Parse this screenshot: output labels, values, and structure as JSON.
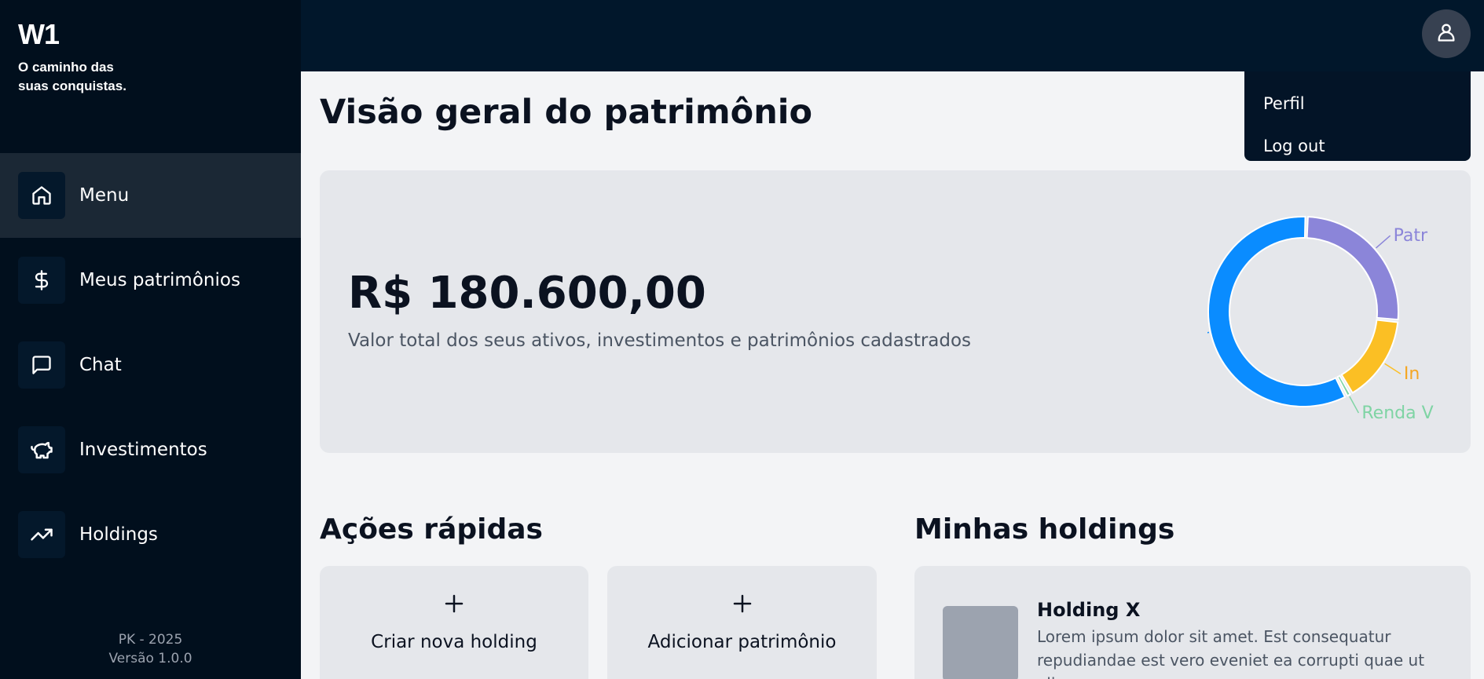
{
  "brand": {
    "logo": "W1",
    "tagline": "O caminho das suas conquistas."
  },
  "nav": {
    "items": [
      {
        "label": "Menu",
        "icon": "home-icon",
        "active": true
      },
      {
        "label": "Meus patrimônios",
        "icon": "dollar-icon",
        "active": false
      },
      {
        "label": "Chat",
        "icon": "chat-icon",
        "active": false
      },
      {
        "label": "Investimentos",
        "icon": "piggy-bank-icon",
        "active": false
      },
      {
        "label": "Holdings",
        "icon": "trending-up-icon",
        "active": false
      }
    ]
  },
  "footer": {
    "line1": "PK - 2025",
    "line2": "Versão 1.0.0"
  },
  "user_menu": {
    "icon": "user-icon",
    "items": [
      "Perfil",
      "Log out"
    ]
  },
  "main": {
    "title": "Visão geral do patrimônio",
    "total_value": "R$ 180.600,00",
    "total_desc": "Valor total dos seus ativos, investimentos e patrimônios cadastrados"
  },
  "chart_data": {
    "type": "pie",
    "style": "donut",
    "categories": [
      "Patr",
      "In",
      "Renda V",
      ""
    ],
    "values": [
      26,
      15,
      1,
      58
    ],
    "colors": [
      "#8b85d9",
      "#fbbf24",
      "#7fd4a4",
      "#0a8cff"
    ],
    "labels_visible": [
      "Patr",
      "In",
      "Renda V"
    ],
    "label_colors": [
      "#8b85d9",
      "#f5a623",
      "#7fd4a4"
    ]
  },
  "quick_actions": {
    "title": "Ações rápidas",
    "items": [
      {
        "label": "Criar nova holding",
        "icon": "plus-icon"
      },
      {
        "label": "Adicionar patrimônio",
        "icon": "plus-icon"
      }
    ]
  },
  "holdings": {
    "title": "Minhas holdings",
    "items": [
      {
        "name": "Holding X",
        "description": "Lorem ipsum dolor sit amet. Est consequatur repudiandae est vero eveniet ea corrupti quae ut alias"
      }
    ]
  }
}
